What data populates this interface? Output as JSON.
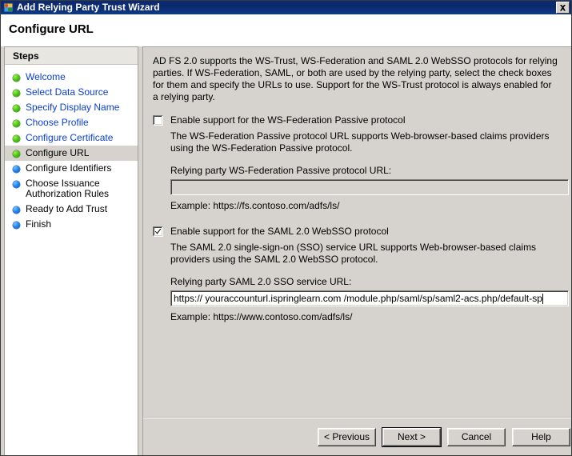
{
  "window": {
    "title": "Add Relying Party Trust Wizard",
    "icon": "wizard-certificate-icon",
    "close_label": "Close",
    "page_title": "Configure URL"
  },
  "sidebar": {
    "header": "Steps",
    "items": [
      {
        "label": "Welcome",
        "state": "done"
      },
      {
        "label": "Select Data Source",
        "state": "done"
      },
      {
        "label": "Specify Display Name",
        "state": "done"
      },
      {
        "label": "Choose Profile",
        "state": "done"
      },
      {
        "label": "Configure Certificate",
        "state": "done"
      },
      {
        "label": "Configure URL",
        "state": "current"
      },
      {
        "label": "Configure Identifiers",
        "state": "todo"
      },
      {
        "label": "Choose Issuance Authorization Rules",
        "state": "todo"
      },
      {
        "label": "Ready to Add Trust",
        "state": "todo"
      },
      {
        "label": "Finish",
        "state": "todo"
      }
    ]
  },
  "main": {
    "intro": "AD FS 2.0 supports the WS-Trust, WS-Federation and SAML 2.0 WebSSO protocols for relying parties.  If WS-Federation, SAML, or both are used by the relying party, select the check boxes for them and specify the URLs to use.  Support for the WS-Trust protocol is always enabled for a relying party.",
    "wsfed": {
      "checkbox_label": "Enable support for the WS-Federation Passive protocol",
      "checkbox_accelerator": "E",
      "checked": false,
      "description": "The WS-Federation Passive protocol URL supports Web-browser-based claims providers using the WS-Federation Passive protocol.",
      "field_label": "Relying party WS-Federation Passive protocol URL:",
      "field_label_accelerator": "W",
      "value": "",
      "example": "Example: https://fs.contoso.com/adfs/ls/"
    },
    "saml": {
      "checkbox_label": "Enable support for the SAML 2.0 WebSSO protocol",
      "checkbox_accelerator": "a",
      "checked": true,
      "description": "The SAML 2.0 single-sign-on (SSO) service URL supports Web-browser-based claims providers using the SAML 2.0 WebSSO protocol.",
      "field_label": "Relying party SAML 2.0 SSO service URL:",
      "field_label_accelerator": "S",
      "value": "https:// youraccounturl.ispringlearn.com /module.php/saml/sp/saml2-acs.php/default-sp",
      "example": "Example: https://www.contoso.com/adfs/ls/"
    }
  },
  "footer": {
    "buttons": [
      {
        "label": "< Previous",
        "default": false
      },
      {
        "label": "Next >",
        "default": true
      },
      {
        "label": "Cancel",
        "default": false
      },
      {
        "label": "Help",
        "default": false
      }
    ]
  },
  "colors": {
    "titlebar": "#0c2a70",
    "dialog_face": "#d6d3ce",
    "link_blue": "#0b3fd4",
    "bullet_done": "#4cc417",
    "bullet_todo": "#1e82ef"
  }
}
